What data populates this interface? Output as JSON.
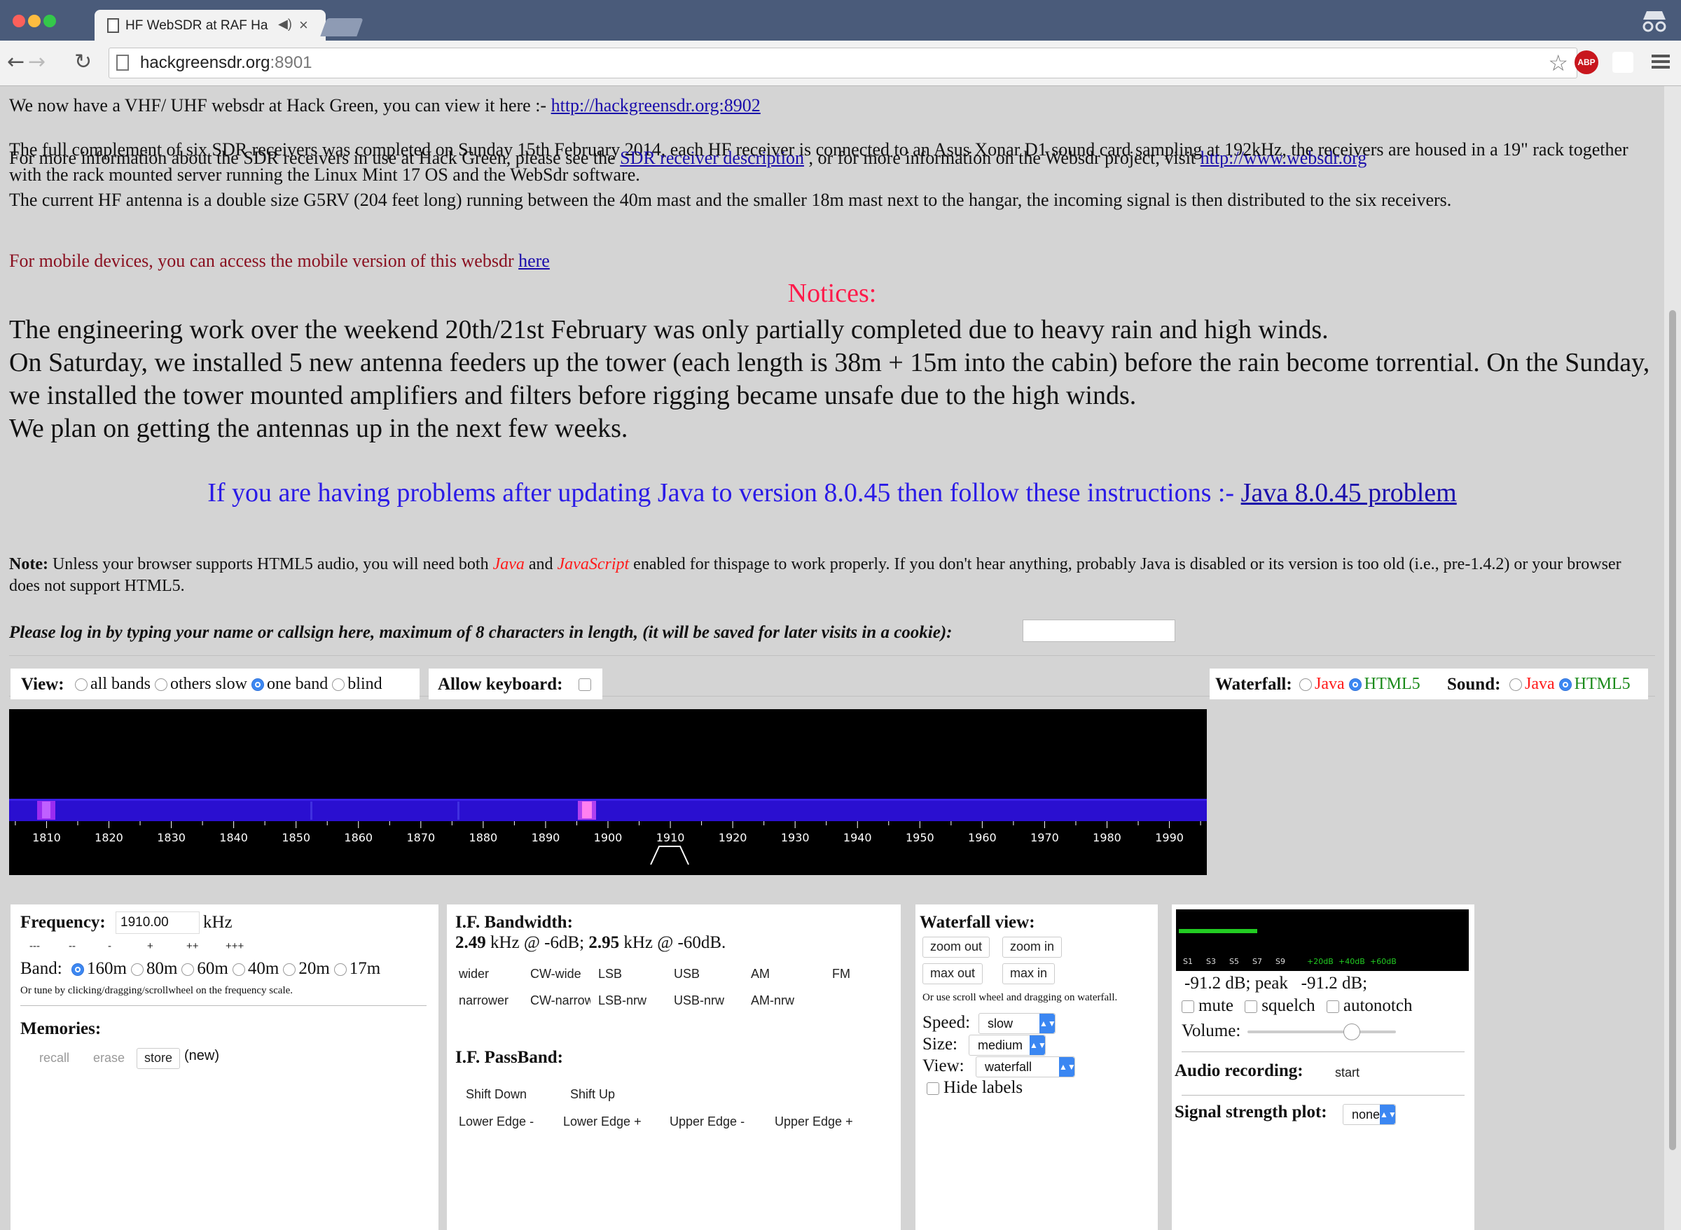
{
  "browser": {
    "tab_title": "HF WebSDR at RAF Ha",
    "tab_sound_icon": "speaker-icon",
    "tab_close": "×",
    "url_host": "hackgreensdr.org",
    "url_port": ":8901",
    "abp_label": "ABP",
    "back": "←",
    "forward": "→",
    "reload": "↻",
    "star": "☆"
  },
  "intro": {
    "vhf_text": "We now have a VHF/ UHF websdr at Hack Green, you can view it here :- ",
    "vhf_link": "http://hackgreensdr.org:8902",
    "complement": "The full complement of six SDR receivers was completed on Sunday 15th February 2014, each HF receiver is connected to an Asus Xonar D1 sound card sampling at 192kHz, the receivers are housed in a 19\" rack together with the rack mounted server running the Linux Mint 17 OS and the WebSdr software.",
    "antenna": "The current HF antenna is a double size G5RV (204 feet long) running between the 40m mast and the smaller 18m mast next to the hangar, the incoming signal is then distributed to the six receivers.",
    "more_info_1": "For more information about the SDR receivers in use at Hack Green, please see the ",
    "more_info_link1": "SDR receiver description",
    "more_info_2": " , or for more information on the Websdr project, visit ",
    "more_info_link2": "http://www.websdr.org ",
    "mobile_text": "For mobile devices, you can access the mobile version of this websdr ",
    "mobile_link": "here "
  },
  "notices": {
    "heading": "Notices:",
    "line1": "The engineering work over the weekend 20th/21st February was only partially completed due to heavy rain and high winds.",
    "line2": "On Saturday, we installed 5 new antenna feeders up the tower (each length is 38m + 15m into the cabin) before the rain become torrential. On the Sunday, we installed the tower mounted amplifiers and filters before rigging became unsafe due to the high winds.",
    "line3": "We plan on getting the antennas up in the next few weeks.",
    "java_text": "If you are having problems after updating Java to version 8.0.45 then follow these instructions :- ",
    "java_link": "Java 8.0.45 problem"
  },
  "note": {
    "label": "Note:",
    "t1": " Unless your browser supports HTML5 audio, you will need both ",
    "java": "Java",
    "and": " and ",
    "javascript": "JavaScript",
    "t2": " enabled for thispage to work properly. If you don't hear anything, probably Java is disabled or its version is too old (i.e., pre-1.4.2) or your browser does not support HTML5."
  },
  "login": {
    "prompt": "Please log in by typing your name or callsign here, maximum of 8 characters in length, (it will be saved for later visits in a cookie):",
    "value": ""
  },
  "view": {
    "label": "View:",
    "options": [
      "all bands",
      "others slow",
      "one band",
      "blind"
    ],
    "selected": 2,
    "keyboard_label": "Allow keyboard:",
    "waterfall_label": "Waterfall:",
    "sound_label": "Sound:",
    "java": "Java",
    "html5": "HTML5"
  },
  "scale": {
    "ticks": [
      "1810",
      "1820",
      "1830",
      "1840",
      "1850",
      "1860",
      "1870",
      "1880",
      "1890",
      "1900",
      "1910",
      "1920",
      "1930",
      "1940",
      "1950",
      "1960",
      "1970",
      "1980",
      "1990"
    ],
    "tuned": 1910
  },
  "freq": {
    "label": "Frequency:",
    "value": "1910.00",
    "unit": "kHz",
    "steps": [
      "---",
      "--",
      "-",
      "+",
      "++",
      "+++"
    ],
    "band_label": "Band:",
    "bands": [
      "160m",
      "80m",
      "60m",
      "40m",
      "20m",
      "17m"
    ],
    "band_selected": 0,
    "tune_hint": "Or tune by clicking/dragging/scrollwheel on the frequency scale.",
    "memories_label": "Memories:",
    "recall": "recall",
    "erase": "erase",
    "store": "store",
    "new": "(new)"
  },
  "ifbw": {
    "label": "I.F. Bandwidth:",
    "val1": "2.49",
    "txt1": " kHz @ -6dB; ",
    "val2": "2.95",
    "txt2": " kHz @ -60dB.",
    "row1": [
      "wider",
      "CW-wide",
      "LSB",
      "USB",
      "AM",
      "FM"
    ],
    "row2": [
      "narrower",
      "CW-narrow",
      "LSB-nrw",
      "USB-nrw",
      "AM-nrw"
    ],
    "passband_label": "I.F. PassBand:",
    "shift_down": "Shift Down",
    "shift_up": "Shift Up",
    "edges": [
      "Lower Edge -",
      "Lower Edge +",
      "Upper Edge -",
      "Upper Edge +"
    ]
  },
  "wfview": {
    "label": "Waterfall view:",
    "zoom_out": "zoom out",
    "zoom_in": "zoom in",
    "max_out": "max out",
    "max_in": "max in",
    "hint": "Or use scroll wheel and dragging on waterfall.",
    "speed_label": "Speed:",
    "speed": "slow",
    "size_label": "Size:",
    "size": "medium",
    "view_label": "View:",
    "view": "waterfall",
    "hide_labels": "Hide labels"
  },
  "audio": {
    "meter_labels": [
      "S1",
      "S3",
      "S5",
      "S7",
      "S9",
      "+20dB",
      "+40dB",
      "+60dB"
    ],
    "level_text": "-91.2 dB; peak   -91.2 dB;",
    "mute": "mute",
    "squelch": "squelch",
    "autonotch": "autonotch",
    "volume_label": "Volume:",
    "volume": 0.7,
    "recording_label": "Audio recording:",
    "start": "start",
    "plot_label": "Signal strength plot:",
    "plot": "none"
  },
  "colors": {
    "notice_heading": "#ff1a4a",
    "mobile_text": "#8a1020",
    "java_line": "#2a1ae6",
    "note_red": "#ff1a1a",
    "wf_blue": "#2a0fd0",
    "radio_on": "#3b87f2",
    "meter_green": "#22cc22"
  }
}
